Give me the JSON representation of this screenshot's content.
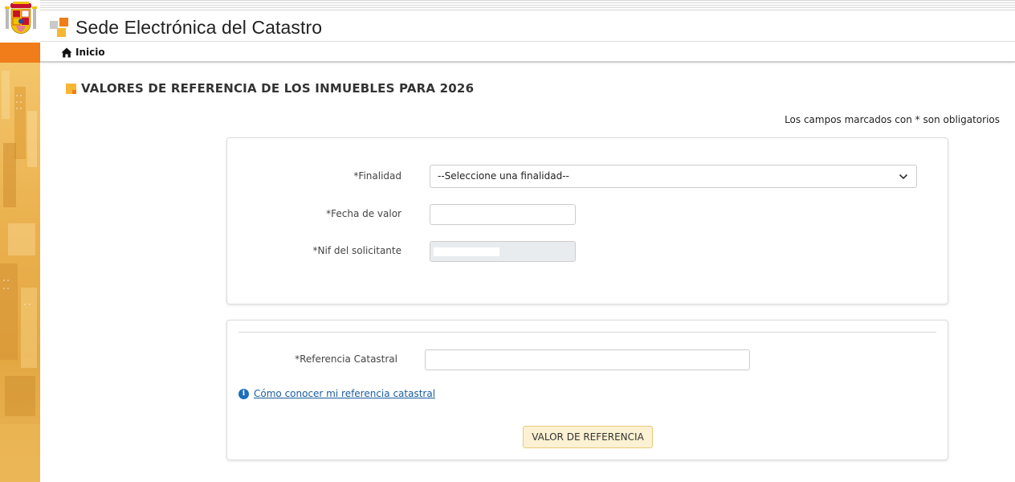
{
  "header": {
    "site_title": "Sede Electrónica del Catastro"
  },
  "nav": {
    "home_label": "Inicio",
    "home_icon": "home-icon"
  },
  "page": {
    "title": "VALORES DE REFERENCIA DE LOS INMUEBLES PARA 2026",
    "required_note": "Los campos marcados con * son obligatorios"
  },
  "form": {
    "finalidad": {
      "label": "*Finalidad",
      "selected": "--Seleccione una finalidad--"
    },
    "fecha_valor": {
      "label": "*Fecha de valor",
      "value": ""
    },
    "nif": {
      "label": "*Nif del solicitante",
      "value": ""
    },
    "referencia": {
      "label": "*Referencia Catastral",
      "value": ""
    },
    "help_link": "Cómo conocer mi referencia catastral",
    "submit_label": "VALOR DE REFERENCIA"
  },
  "colors": {
    "accent_orange": "#f07d19",
    "accent_yellow": "#f7b733",
    "link": "#1a5c9e",
    "button_bg": "#fcf1d2"
  }
}
